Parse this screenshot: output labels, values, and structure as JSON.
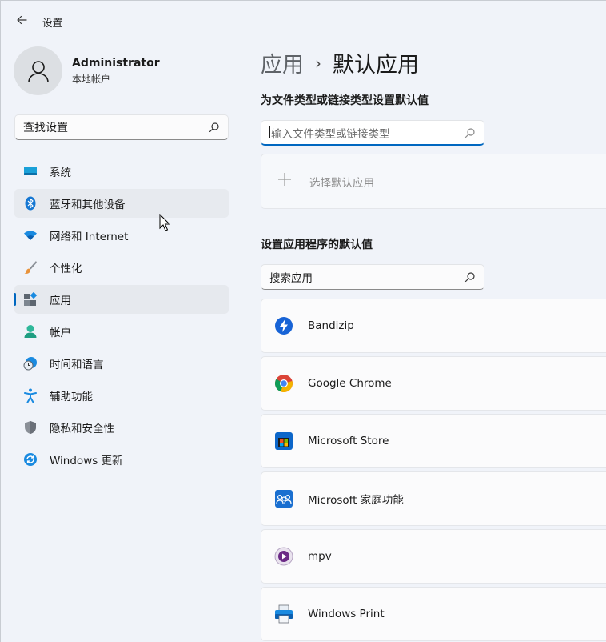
{
  "titlebar": {
    "back_icon": "back-arrow-icon",
    "title": "设置"
  },
  "profile": {
    "name": "Administrator",
    "account_type": "本地帐户",
    "avatar_icon": "user-avatar-icon"
  },
  "sidebar_search": {
    "placeholder": "查找设置",
    "icon": "search-icon"
  },
  "nav": {
    "items": [
      {
        "label": "系统",
        "icon": "system-display-icon",
        "state": "normal"
      },
      {
        "label": "蓝牙和其他设备",
        "icon": "bluetooth-icon",
        "state": "hover"
      },
      {
        "label": "网络和 Internet",
        "icon": "wifi-icon",
        "state": "normal"
      },
      {
        "label": "个性化",
        "icon": "paintbrush-icon",
        "state": "normal"
      },
      {
        "label": "应用",
        "icon": "apps-icon",
        "state": "active"
      },
      {
        "label": "帐户",
        "icon": "account-icon",
        "state": "normal"
      },
      {
        "label": "时间和语言",
        "icon": "time-language-icon",
        "state": "normal"
      },
      {
        "label": "辅助功能",
        "icon": "accessibility-icon",
        "state": "normal"
      },
      {
        "label": "隐私和安全性",
        "icon": "shield-icon",
        "state": "normal"
      },
      {
        "label": "Windows 更新",
        "icon": "windows-update-icon",
        "state": "normal"
      }
    ]
  },
  "breadcrumb": {
    "parent": "应用",
    "separator": "›",
    "current": "默认应用"
  },
  "file_type_section": {
    "title": "为文件类型或链接类型设置默认值",
    "input_placeholder": "输入文件类型或链接类型",
    "choose_label": "选择默认应用"
  },
  "apps_section": {
    "title": "设置应用程序的默认值",
    "search_placeholder": "搜索应用",
    "apps": [
      {
        "name": "Bandizip",
        "icon": "bandizip-icon"
      },
      {
        "name": "Google Chrome",
        "icon": "chrome-icon"
      },
      {
        "name": "Microsoft Store",
        "icon": "microsoft-store-icon"
      },
      {
        "name": "Microsoft 家庭功能",
        "icon": "microsoft-family-icon"
      },
      {
        "name": "mpv",
        "icon": "mpv-icon"
      },
      {
        "name": "Windows Print",
        "icon": "windows-print-icon"
      }
    ]
  },
  "colors": {
    "accent": "#0067c0",
    "background": "#f0f3f9"
  }
}
